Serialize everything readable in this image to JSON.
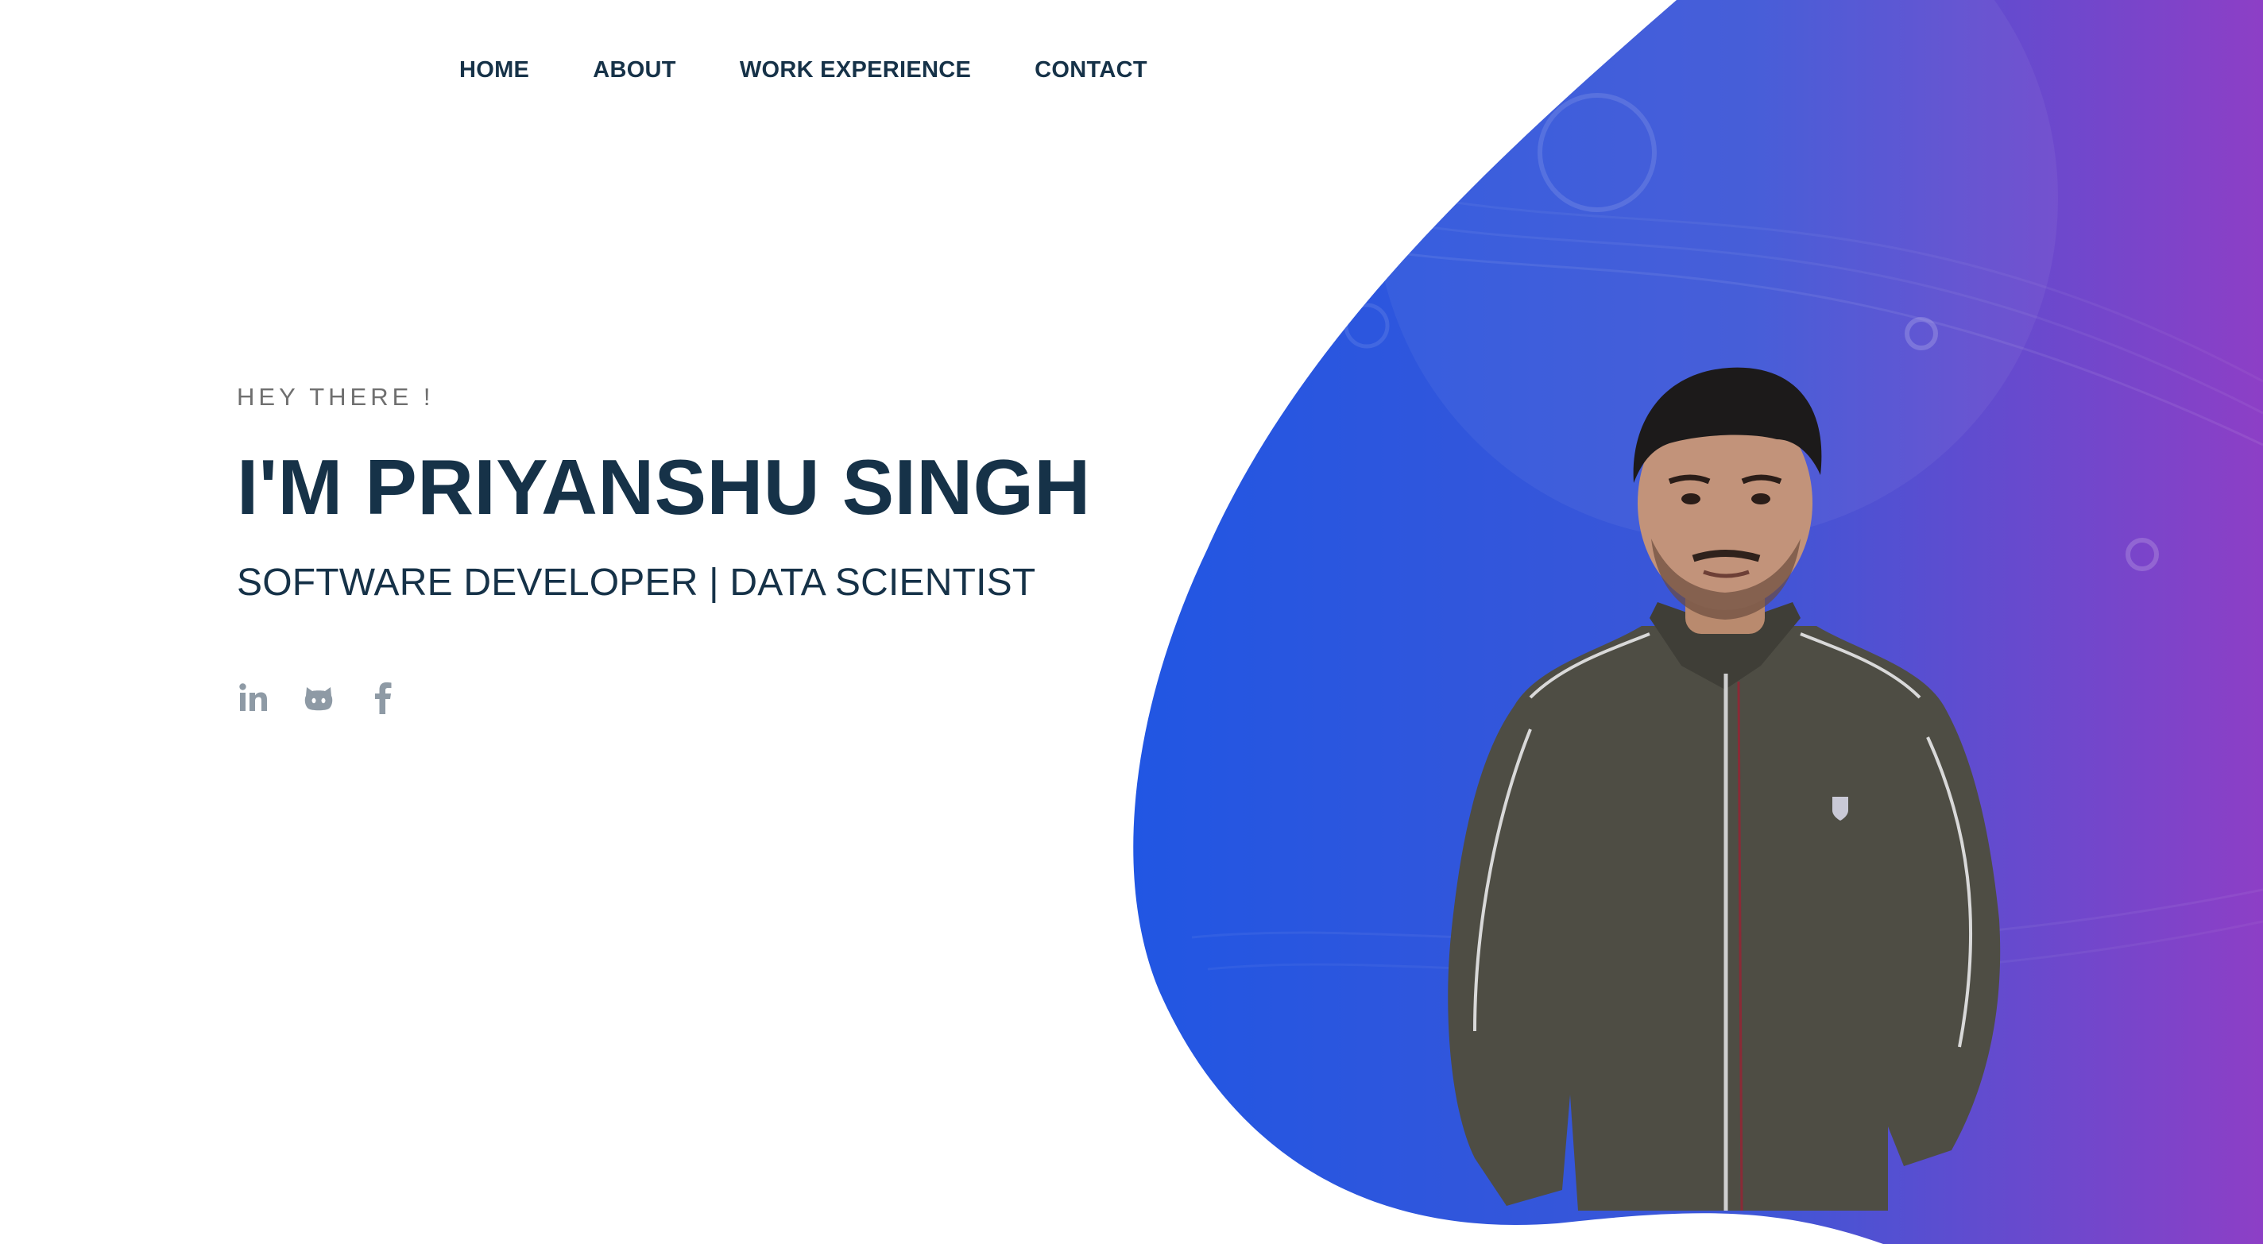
{
  "nav": {
    "items": [
      {
        "label": "HOME"
      },
      {
        "label": "ABOUT"
      },
      {
        "label": "WORK EXPERIENCE"
      },
      {
        "label": "CONTACT"
      }
    ]
  },
  "hero": {
    "greeting": "HEY THERE !",
    "name": "I'M PRIYANSHU SINGH",
    "role": "SOFTWARE DEVELOPER | DATA SCIENTIST"
  },
  "social": {
    "icons": [
      "linkedin-icon",
      "github-icon",
      "facebook-icon"
    ],
    "icon_color": "#8e9aa5"
  },
  "theme": {
    "text_dark": "#163248",
    "text_muted": "#6f6f6f",
    "gradient_start": "#1f5be0",
    "gradient_end": "#8e3fc7"
  }
}
